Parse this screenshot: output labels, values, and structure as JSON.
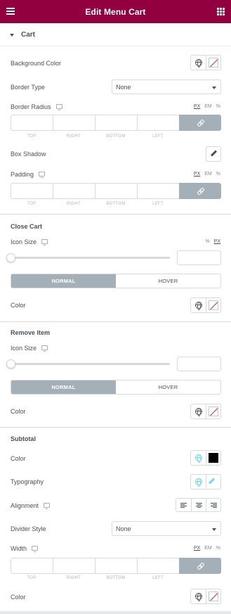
{
  "header": {
    "title": "Edit Menu Cart",
    "menu_icon": "hamburger-icon",
    "apps_icon": "grid-icon",
    "color": "#93003f"
  },
  "cart": {
    "title": "Cart",
    "background_color_label": "Background Color",
    "border_type_label": "Border Type",
    "border_type_value": "None",
    "border_radius_label": "Border Radius",
    "border_radius_units": [
      "PX",
      "EM",
      "%"
    ],
    "box_shadow_label": "Box Shadow",
    "padding_label": "Padding",
    "padding_units": [
      "PX",
      "EM",
      "%"
    ],
    "dimension_labels": [
      "TOP",
      "RIGHT",
      "BOTTOM",
      "LEFT"
    ]
  },
  "close_cart": {
    "title": "Close Cart",
    "icon_size_label": "Icon Size",
    "icon_size_units": [
      "%",
      "PX"
    ],
    "tabs": [
      "NORMAL",
      "HOVER"
    ],
    "color_label": "Color"
  },
  "remove_item": {
    "title": "Remove Item",
    "icon_size_label": "Icon Size",
    "tabs": [
      "NORMAL",
      "HOVER"
    ],
    "color_label": "Color"
  },
  "subtotal": {
    "title": "Subtotal",
    "color_label": "Color",
    "typography_label": "Typography",
    "alignment_label": "Alignment",
    "divider_style_label": "Divider Style",
    "divider_style_value": "None",
    "width_label": "Width",
    "width_units": [
      "PX",
      "EM",
      "%"
    ],
    "dimension_labels": [
      "TOP",
      "RIGHT",
      "BOTTOM",
      "LEFT"
    ],
    "color2_label": "Color",
    "swatch_color": "#000000"
  }
}
